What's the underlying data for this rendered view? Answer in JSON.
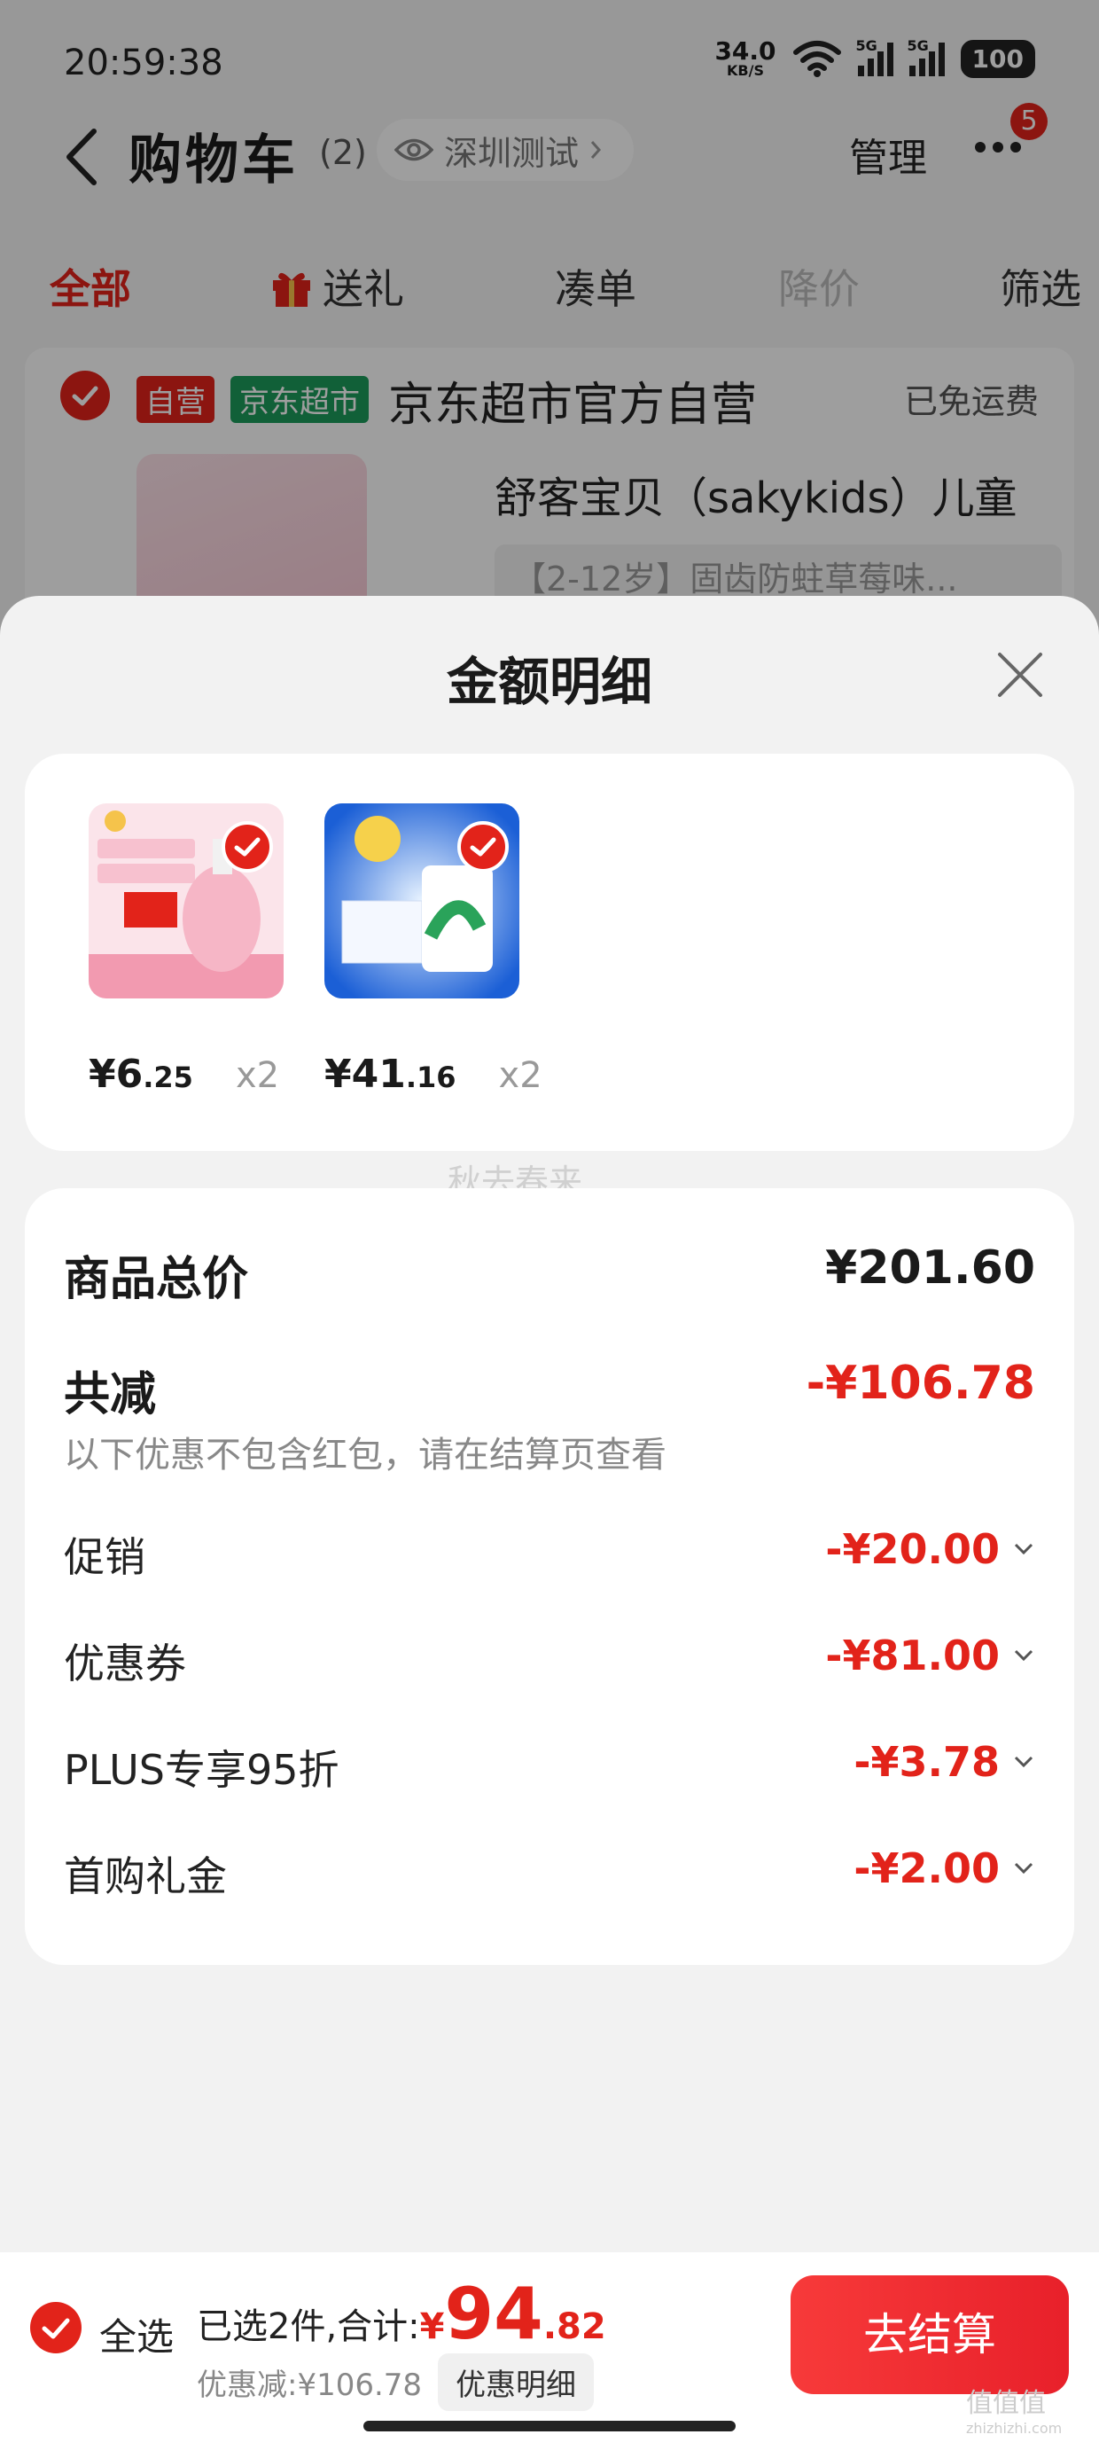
{
  "status_bar": {
    "time": "20:59:38",
    "net_speed_value": "34.0",
    "net_speed_unit": "KB/S",
    "signal1": "5G",
    "signal2": "5G",
    "battery": "100"
  },
  "header": {
    "title": "购物车",
    "count": "(2)",
    "location": "深圳测试",
    "manage": "管理",
    "more_badge": "5"
  },
  "tabs": [
    {
      "label": "全部"
    },
    {
      "label": "送礼"
    },
    {
      "label": "凑单"
    },
    {
      "label": "降价"
    },
    {
      "label": "筛选"
    }
  ],
  "store": {
    "tag_ziying": "自营",
    "tag_chaoshi": "京东超市",
    "name": "京东超市官方自营",
    "free_ship": "已免运费",
    "product_name": "舒客宝贝（sakykids）儿童",
    "product_spec": "【2-12岁】固齿防蛀草莓味..."
  },
  "sheet": {
    "title": "金额明细",
    "items": [
      {
        "price_int": "6",
        "price_dec": ".25",
        "qty": "x2"
      },
      {
        "price_int": "41",
        "price_dec": ".16",
        "qty": "x2"
      }
    ],
    "yen": "¥",
    "watermark": "秋去春来",
    "total_label": "商品总价",
    "total_value": "¥201.60",
    "reduce_label": "共减",
    "reduce_value": "-¥106.78",
    "note": "以下优惠不包含红包，请在结算页查看",
    "details": [
      {
        "label": "促销",
        "value": "-¥20.00"
      },
      {
        "label": "优惠券",
        "value": "-¥81.00"
      },
      {
        "label": "PLUS专享95折",
        "value": "-¥3.78"
      },
      {
        "label": "首购礼金",
        "value": "-¥2.00"
      }
    ]
  },
  "bottom_bar": {
    "select_all": "全选",
    "selected_text": "已选2件,合计:",
    "currency": "¥",
    "total_int": "94",
    "total_dec": ".82",
    "discount_text": "优惠减:¥106.78",
    "detail_button": "优惠明细",
    "checkout": "去结算"
  },
  "corner_logo": "值值值",
  "corner_logo_sub": "zhizhizhi.com",
  "colors": {
    "accent": "#e2231a",
    "sheet_bg": "#f2f2f2",
    "card_bg": "#ffffff"
  }
}
